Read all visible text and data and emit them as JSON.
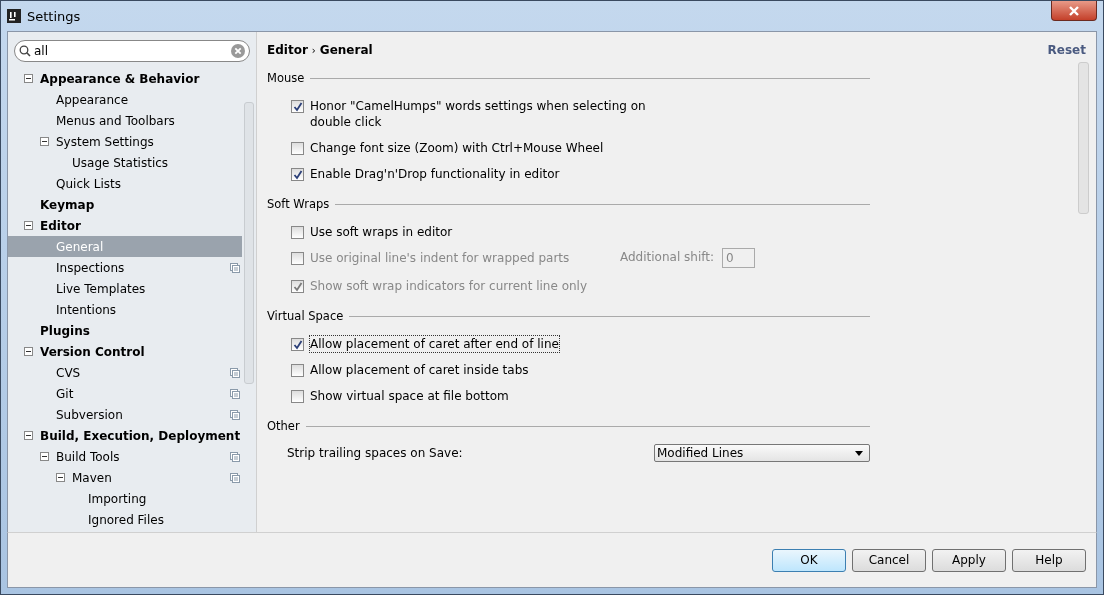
{
  "window": {
    "title": "Settings"
  },
  "search": {
    "value": "all"
  },
  "tree": [
    {
      "label": "Appearance & Behavior",
      "expanded": true,
      "selected": false,
      "copy_icon": false,
      "children": [
        {
          "label": "Appearance",
          "selected": false,
          "copy_icon": false
        },
        {
          "label": "Menus and Toolbars",
          "selected": false,
          "copy_icon": false
        },
        {
          "label": "System Settings",
          "expanded": true,
          "selected": false,
          "copy_icon": false,
          "children": [
            {
              "label": "Usage Statistics",
              "selected": false,
              "copy_icon": false
            }
          ]
        },
        {
          "label": "Quick Lists",
          "selected": false,
          "copy_icon": false
        }
      ]
    },
    {
      "label": "Keymap",
      "selected": false,
      "copy_icon": false
    },
    {
      "label": "Editor",
      "expanded": true,
      "selected": false,
      "copy_icon": false,
      "children": [
        {
          "label": "General",
          "selected": true,
          "copy_icon": false
        },
        {
          "label": "Inspections",
          "selected": false,
          "copy_icon": true
        },
        {
          "label": "Live Templates",
          "selected": false,
          "copy_icon": false
        },
        {
          "label": "Intentions",
          "selected": false,
          "copy_icon": false
        }
      ]
    },
    {
      "label": "Plugins",
      "selected": false,
      "copy_icon": false
    },
    {
      "label": "Version Control",
      "expanded": true,
      "selected": false,
      "copy_icon": false,
      "children": [
        {
          "label": "CVS",
          "selected": false,
          "copy_icon": true
        },
        {
          "label": "Git",
          "selected": false,
          "copy_icon": true
        },
        {
          "label": "Subversion",
          "selected": false,
          "copy_icon": true
        }
      ]
    },
    {
      "label": "Build, Execution, Deployment",
      "expanded": true,
      "selected": false,
      "copy_icon": false,
      "children": [
        {
          "label": "Build Tools",
          "expanded": true,
          "selected": false,
          "copy_icon": true,
          "children": [
            {
              "label": "Maven",
              "expanded": true,
              "selected": false,
              "copy_icon": true,
              "children": [
                {
                  "label": "Importing",
                  "selected": false,
                  "copy_icon": false
                },
                {
                  "label": "Ignored Files",
                  "selected": false,
                  "copy_icon": false
                }
              ]
            }
          ]
        }
      ]
    }
  ],
  "breadcrumb": [
    "Editor",
    "General"
  ],
  "breadcrumb_separator": "›",
  "reset": "Reset",
  "sections": [
    {
      "title": "Mouse",
      "options": [
        {
          "kind": "checkbox",
          "label": "Honor \"CamelHumps\" words settings when selecting on double click",
          "checked": true,
          "disabled": false,
          "focused": false
        },
        {
          "kind": "checkbox",
          "label": "Change font size (Zoom) with Ctrl+Mouse Wheel",
          "checked": false,
          "disabled": false,
          "focused": false
        },
        {
          "kind": "checkbox",
          "label": "Enable Drag'n'Drop functionality in editor",
          "checked": true,
          "disabled": false,
          "focused": false
        }
      ]
    },
    {
      "title": "Soft Wraps",
      "options": [
        {
          "kind": "checkbox",
          "label": "Use soft wraps in editor",
          "checked": false,
          "disabled": false,
          "focused": false
        },
        {
          "kind": "checkbox_with_field",
          "label": "Use original line's indent for wrapped parts",
          "checked": false,
          "disabled": true,
          "focused": false,
          "field_label": "Additional shift:",
          "field_value": "0"
        },
        {
          "kind": "checkbox",
          "label": "Show soft wrap indicators for current line only",
          "checked": true,
          "disabled": true,
          "focused": false
        }
      ]
    },
    {
      "title": "Virtual Space",
      "options": [
        {
          "kind": "checkbox",
          "label": "Allow placement of caret after end of line",
          "checked": true,
          "disabled": false,
          "focused": true
        },
        {
          "kind": "checkbox",
          "label": "Allow placement of caret inside tabs",
          "checked": false,
          "disabled": false,
          "focused": false
        },
        {
          "kind": "checkbox",
          "label": "Show virtual space at file bottom",
          "checked": false,
          "disabled": false,
          "focused": false
        }
      ]
    },
    {
      "title": "Other",
      "options": [
        {
          "kind": "dropdown",
          "label": "Strip trailing spaces on Save:",
          "value": "Modified Lines"
        }
      ]
    }
  ],
  "buttons": [
    {
      "label": "OK",
      "selected": true
    },
    {
      "label": "Cancel",
      "selected": false
    },
    {
      "label": "Apply",
      "selected": false
    },
    {
      "label": "Help",
      "selected": false
    }
  ]
}
